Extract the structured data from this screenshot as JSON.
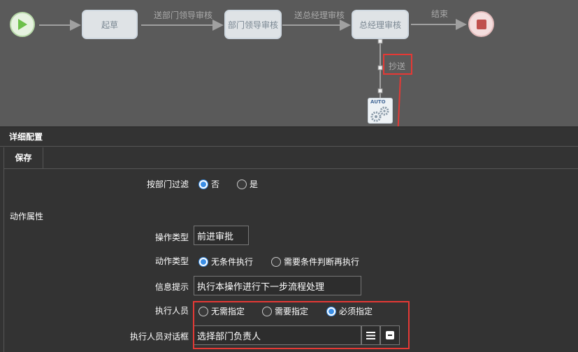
{
  "flow": {
    "nodes": {
      "draft": "起草",
      "dept_leader": "部门领导审核",
      "gm": "总经理审核"
    },
    "edges": {
      "to_dept": "送部门领导审核",
      "to_gm": "送总经理审核",
      "end": "结束",
      "cc": "抄送"
    },
    "auto_badge": "AUTO"
  },
  "panel": {
    "title": "详细配置",
    "save_label": "保存",
    "dept_filter": {
      "label": "按部门过滤",
      "options": [
        "否",
        "是"
      ],
      "selected": 0
    },
    "action_section": "动作属性",
    "op_type": {
      "label": "操作类型",
      "value": "前进审批"
    },
    "action_type": {
      "label": "动作类型",
      "options": [
        "无条件执行",
        "需要条件判断再执行"
      ],
      "selected": 0
    },
    "info_tip": {
      "label": "信息提示",
      "value": "执行本操作进行下一步流程处理"
    },
    "executor": {
      "label": "执行人员",
      "options": [
        "无需指定",
        "需要指定",
        "必须指定"
      ],
      "selected": 2
    },
    "executor_dialog": {
      "label": "执行人员对话框",
      "value": "选择部门负责人"
    }
  },
  "colors": {
    "canvas_bg": "#5a5a5a",
    "panel_bg": "#333333",
    "accent": "#3a8ee6",
    "highlight": "#e53935",
    "start_green": "#6cc04a",
    "stop_red": "#c0504d"
  }
}
